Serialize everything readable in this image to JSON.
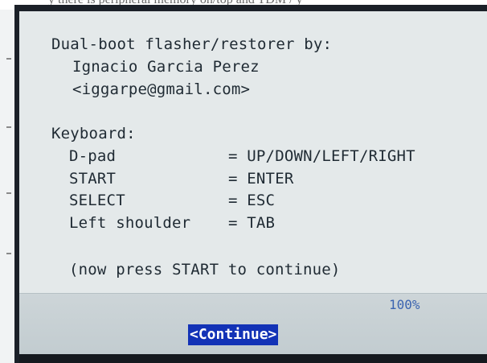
{
  "browser_text": "y there is peripheral memory on/top and TDM / y",
  "dialog": {
    "credit": {
      "title": "Dual-boot flasher/restorer by:",
      "author": "Ignacio Garcia Perez",
      "email": "<iggarpe@gmail.com>"
    },
    "keyboard": {
      "heading": "Keyboard:",
      "mappings": [
        {
          "key": "D-pad",
          "value": "= UP/DOWN/LEFT/RIGHT"
        },
        {
          "key": "START",
          "value": "= ENTER"
        },
        {
          "key": "SELECT",
          "value": "= ESC"
        },
        {
          "key": "Left shoulder",
          "value": "= TAB"
        }
      ]
    },
    "instruction": "(now press START to continue)",
    "progress_percent": "100%",
    "continue_label": "<Continue>"
  },
  "colors": {
    "screen_background": "#e4e9ea",
    "button_bar": "#c8d1d4",
    "button_highlight": "#1232b6",
    "text": "#1f2a33",
    "percent": "#3b64b0"
  }
}
